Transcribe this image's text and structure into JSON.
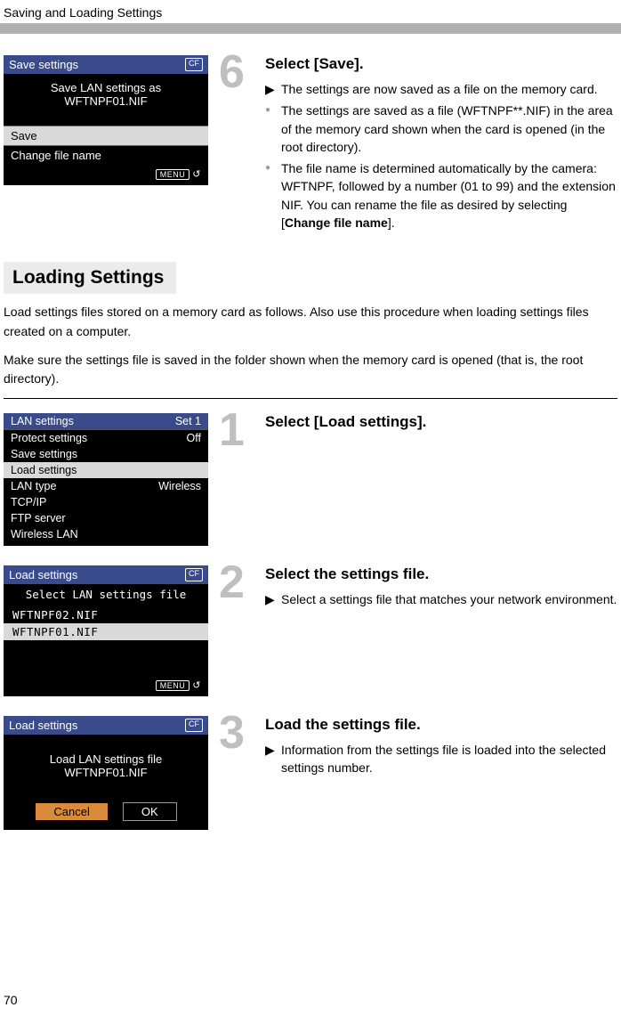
{
  "header": {
    "title": "Saving and Loading Settings"
  },
  "page_number": "70",
  "step6": {
    "number": "6",
    "title": "Select [Save].",
    "line1": "The settings are now saved as a file on the memory card.",
    "line2_a": "The settings are saved as a file (WFTNPF**.NIF) in the area of the memory card shown when the card is opened (in the root directory).",
    "line3_a": "The file name is determined automatically by the camera: WFTNPF, followed by a number (01 to 99) and the extension NIF. You can rename the file as desired by selecting [",
    "line3_b": "Change file name",
    "line3_c": "].",
    "lcd": {
      "title": "Save settings",
      "cf": "CF",
      "body_line1": "Save LAN settings as",
      "body_line2": "WFTNPF01.NIF",
      "menu_save": "Save",
      "menu_change": "Change file name",
      "menu_label": "MENU",
      "back_glyph": "↺"
    }
  },
  "loading": {
    "heading": "Loading Settings",
    "intro1": "Load settings files stored on a memory card as follows. Also use this procedure when loading settings files created on a computer.",
    "intro2": "Make sure the settings file is saved in the folder shown when the memory card is opened (that is, the root directory)."
  },
  "step1": {
    "number": "1",
    "title": "Select [Load settings].",
    "lcd": {
      "row0_l": "LAN settings",
      "row0_r": "Set 1",
      "row1_l": "Protect settings",
      "row1_r": "Off",
      "row2_l": "Save settings",
      "row3_l": "Load settings",
      "row4_l": "LAN type",
      "row4_r": "Wireless",
      "row5_l": "TCP/IP",
      "row6_l": "FTP server",
      "row7_l": "Wireless LAN"
    }
  },
  "step2": {
    "number": "2",
    "title": "Select the settings file.",
    "line1": "Select a settings file that matches your network environment.",
    "lcd": {
      "title": "Load settings",
      "cf": "CF",
      "subtitle": "Select LAN settings file",
      "file1": "WFTNPF02.NIF",
      "file2": "WFTNPF01.NIF",
      "menu_label": "MENU",
      "back_glyph": "↺"
    }
  },
  "step3": {
    "number": "3",
    "title": "Load the settings file.",
    "line1": "Information from the settings file is loaded into the selected settings number.",
    "lcd": {
      "title": "Load settings",
      "cf": "CF",
      "body_line1": "Load LAN settings file",
      "body_line2": "WFTNPF01.NIF",
      "btn_cancel": "Cancel",
      "btn_ok": "OK"
    }
  },
  "glyphs": {
    "tri": "▶",
    "dot": "●"
  }
}
